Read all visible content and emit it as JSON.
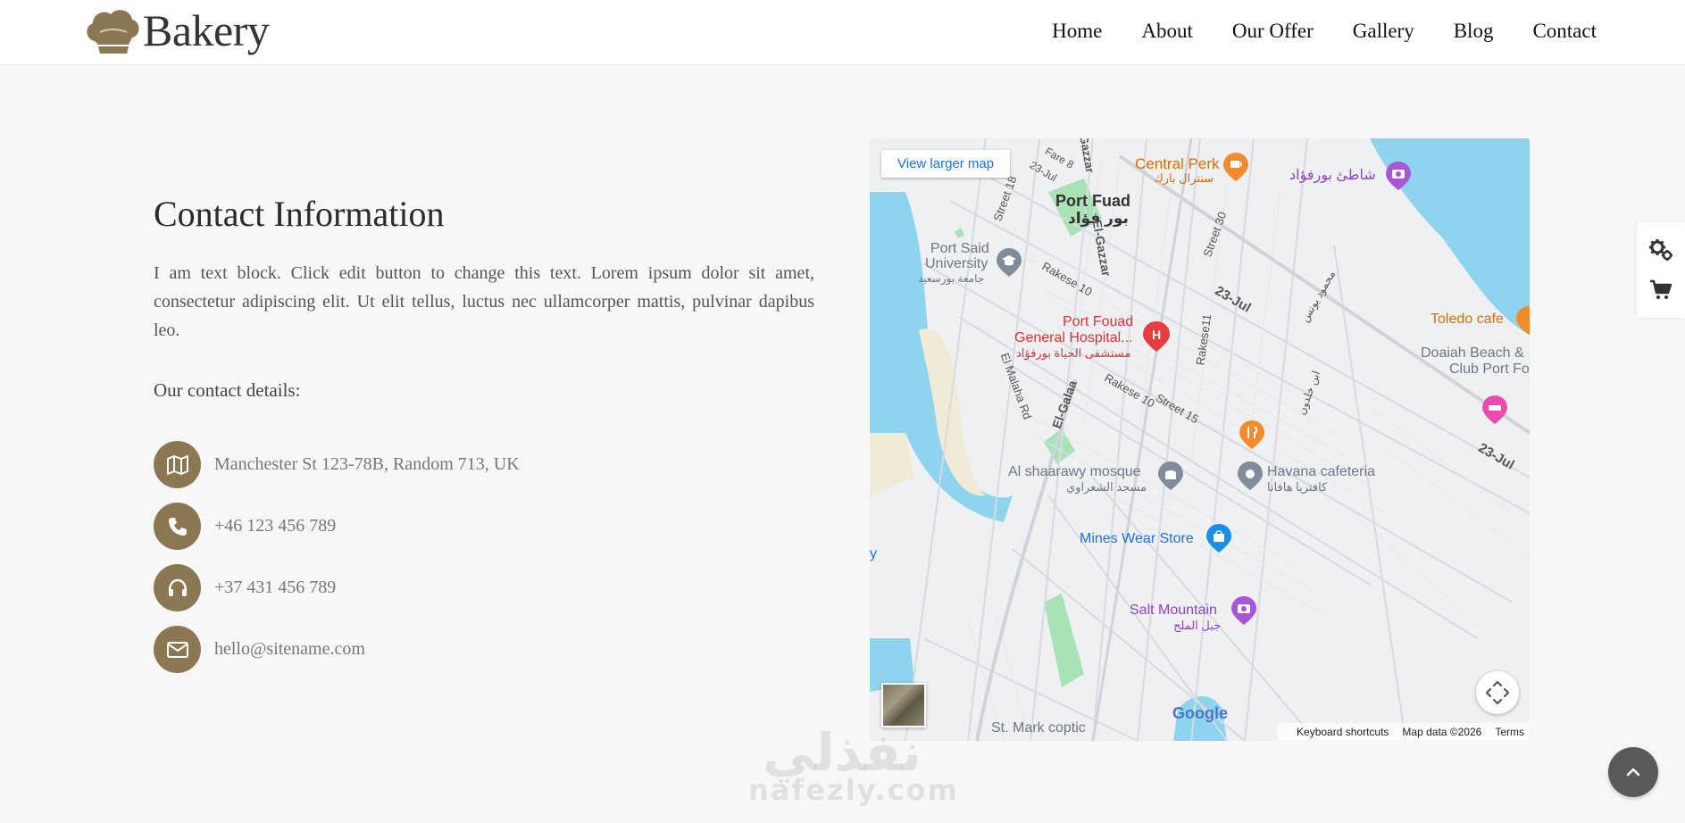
{
  "header": {
    "logo_text": "Bakery",
    "nav": [
      {
        "label": "Home"
      },
      {
        "label": "About"
      },
      {
        "label": "Our Offer"
      },
      {
        "label": "Gallery"
      },
      {
        "label": "Blog"
      },
      {
        "label": "Contact"
      }
    ]
  },
  "contact": {
    "title": "Contact Information",
    "text": "I am text block. Click edit button to change this text. Lorem ipsum dolor sit amet, consectetur adipiscing elit. Ut elit tellus, luctus nec ullamcorper mattis, pulvinar dapibus leo.",
    "details_label": "Our contact details:",
    "items": [
      {
        "icon": "map-icon",
        "value": "Manchester St 123-78B, Random 713, UK"
      },
      {
        "icon": "phone-icon",
        "value": "+46 123 456 789"
      },
      {
        "icon": "headphones-icon",
        "value": "+37 431 456 789"
      },
      {
        "icon": "envelope-icon",
        "value": "hello@sitename.com"
      }
    ]
  },
  "map": {
    "view_larger": "View larger map",
    "footer": {
      "shortcuts": "Keyboard shortcuts",
      "data": "Map data ©2026",
      "terms": "Terms"
    },
    "google_logo": "Google",
    "labels": {
      "port_fuad": "Port Fuad",
      "port_fuad_ar": "بور فؤاد",
      "central_perk": "Central Perk",
      "central_perk_ar": "سنترال بارك",
      "beach_ar": "شاطئ بورفؤاد",
      "port_said_univ_1": "Port Said",
      "port_said_univ_2": "University",
      "port_said_univ_ar": "جامعة بورسعيد",
      "hospital_1": "Port Fouad",
      "hospital_2": "General Hospital...",
      "hospital_ar": "مستشفى الحياة بورفؤاد",
      "toledo": "Toledo cafe",
      "doaiah_1": "Doaiah Beach &",
      "doaiah_2": "Club Port Fo",
      "mosque": "Al shaarawy mosque",
      "mosque_ar": "مسجد الشعراوي",
      "havana": "Havana cafeteria",
      "havana_ar": "كافتريا هافانا",
      "mines": "Mines Wear Store",
      "salt": "Salt Mountain",
      "salt_ar": "جبل الملح",
      "st_mark": "St. Mark coptic",
      "rd_23jul_1": "23-Jul",
      "rd_23jul_2": "23-Jul",
      "rd_el_gazzar": "El-Gazzar",
      "rd_el_galaa": "El-Galaa",
      "rd_rakese10_1": "Rakese 10",
      "rd_rakese10_2": "Rakese 10",
      "rd_street15": "Street 15",
      "rd_street30": "Street 30",
      "rd_street18": "Street 18",
      "rd_el_malaha": "El Malaha Rd",
      "rd_rakese11": "Rakese11",
      "rd_fare8": "Fare 8",
      "rd_23jul_3": "23-Jul",
      "rd_gazzar_top": "Gazzar",
      "rd_mahmoud_younis": "محمود يونس",
      "rd_ibn_khaldoun": "ابن خلدون",
      "edge_y": "y"
    }
  },
  "watermark": {
    "ar": "نفذلي",
    "en": "nafezly.com"
  },
  "colors": {
    "accent": "#8b7853",
    "water": "#8fd4ee",
    "park": "#a8e2b5",
    "hospital": "#e53e3e",
    "food": "#f28b2e",
    "purple": "#a855d6",
    "blue_poi": "#1a73e8"
  }
}
